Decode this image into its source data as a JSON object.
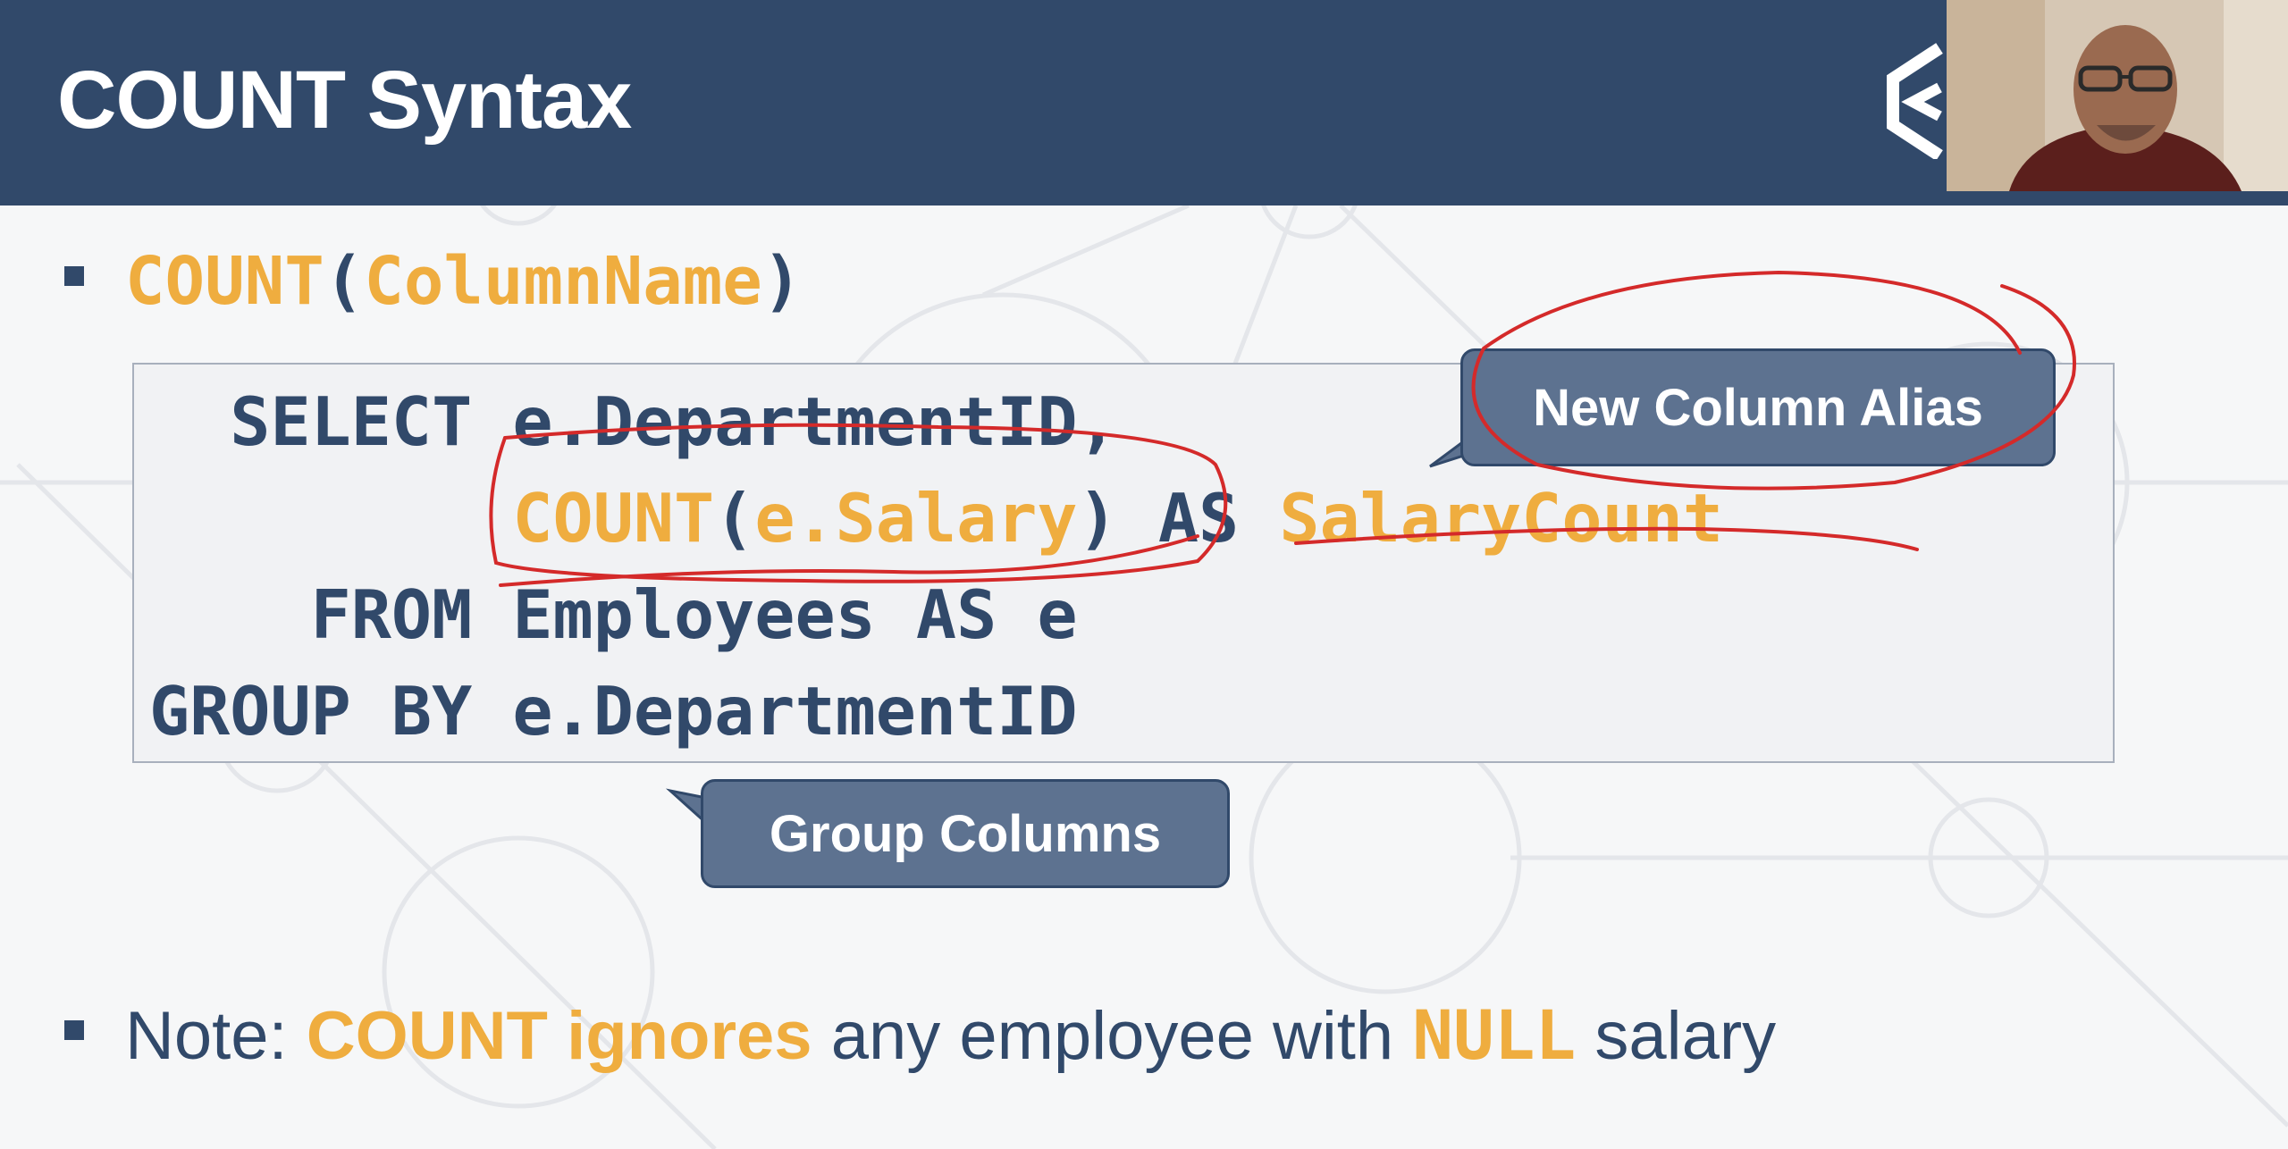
{
  "slide": {
    "title": "COUNT Syntax",
    "syntax": {
      "func": "COUNT",
      "open": "(",
      "arg": "ColumnName",
      "close": ")"
    },
    "code": {
      "line1": "  SELECT e.DepartmentID,",
      "line2_indent": "         ",
      "line2_func": "COUNT",
      "line2_open": "(",
      "line2_arg": "e.Salary",
      "line2_close": ") AS ",
      "line2_alias": "SalaryCount",
      "line3": "    FROM Employees AS e",
      "line4": "GROUP BY e.DepartmentID"
    },
    "callout_alias": "New Column Alias",
    "callout_group": "Group Columns",
    "note": {
      "prefix": "Note: ",
      "highlight1": "COUNT ignores",
      "middle": " any employee with ",
      "highlight2": "NULL",
      "suffix": " salary"
    }
  },
  "colors": {
    "header": "#31496a",
    "accent": "#efad3f",
    "text": "#31496a",
    "callout": "#5d7290",
    "annotation": "#d42a2a"
  },
  "icons": [
    "logo-icon",
    "webcam-presenter"
  ]
}
